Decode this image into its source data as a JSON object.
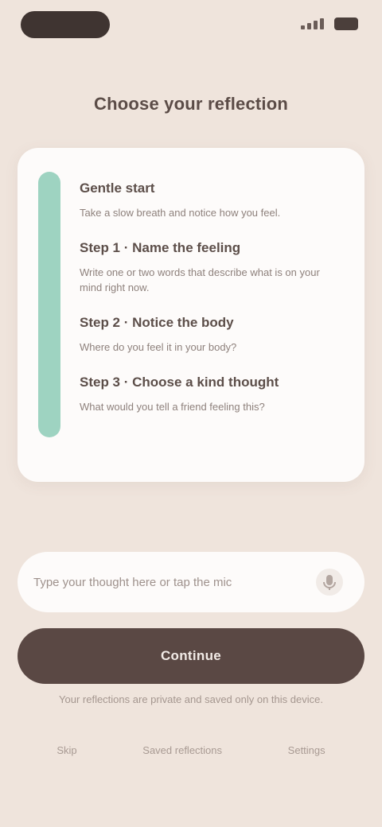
{
  "status_bar": {
    "signal_icon": "signal-icon",
    "battery_icon": "battery-icon"
  },
  "page": {
    "title": "Choose your reflection"
  },
  "card": {
    "accent_color": "#9ed3c1",
    "sections": [
      {
        "title": "Gentle start",
        "text": "Take a slow breath and notice how you feel."
      },
      {
        "title": "Step 1 · Name the feeling",
        "text": "Write one or two words that describe what is on your mind right now."
      },
      {
        "title": "Step 2 · Notice the body",
        "text": "Where do you feel it in your body?"
      },
      {
        "title": "Step 3 · Choose a kind thought",
        "text": "What would you tell a friend feeling this?"
      }
    ]
  },
  "input": {
    "placeholder": "Type your thought here or tap the mic",
    "mic_icon": "mic-icon"
  },
  "primary_button": {
    "label": "Continue"
  },
  "helper": {
    "text": "Your reflections are private and saved only on this device."
  },
  "bottom_links": {
    "items": [
      "Skip",
      "Saved reflections",
      "Settings"
    ]
  }
}
